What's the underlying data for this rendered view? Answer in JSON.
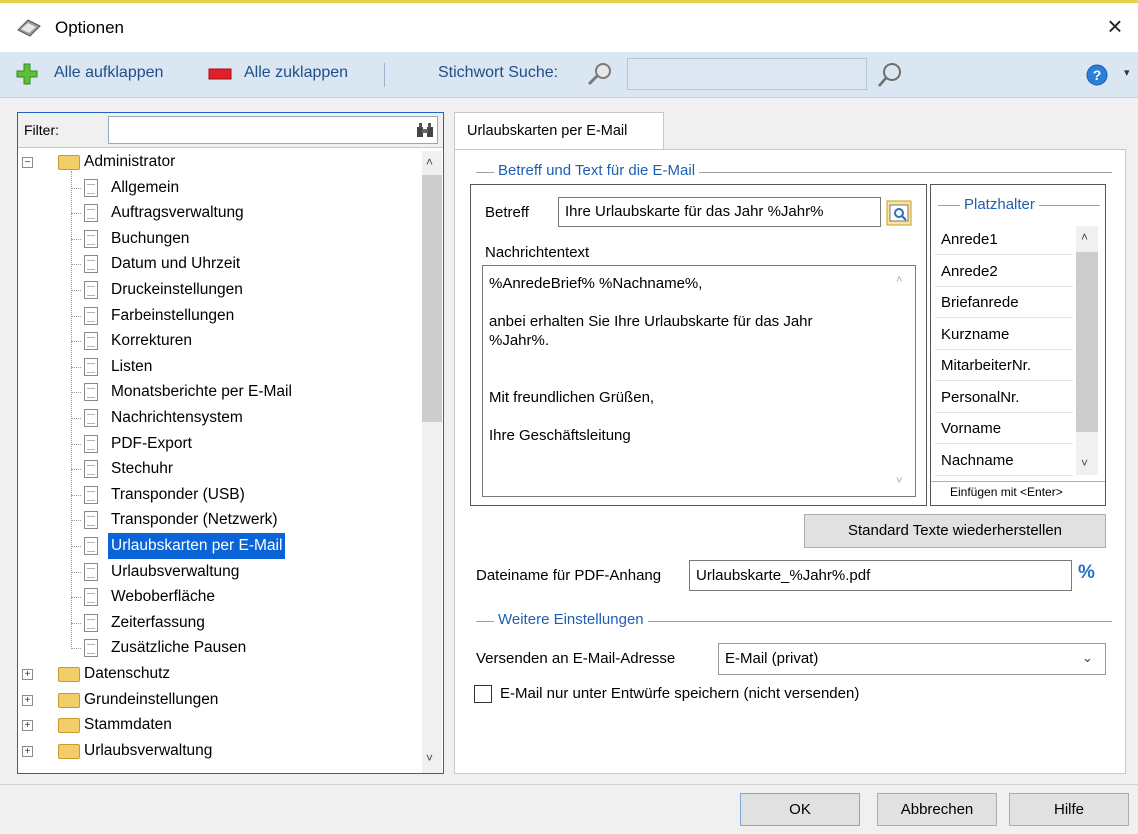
{
  "window": {
    "title": "Optionen",
    "close_label": "×"
  },
  "toolbar": {
    "expand_all": "Alle aufklappen",
    "collapse_all": "Alle zuklappen",
    "keyword_search": "Stichwort Suche:",
    "search_value": "",
    "help_icon": "help-icon"
  },
  "filter": {
    "label": "Filter:",
    "value": ""
  },
  "tree": {
    "root": "Administrator",
    "children": [
      "Allgemein",
      "Auftragsverwaltung",
      "Buchungen",
      "Datum und Uhrzeit",
      "Druckeinstellungen",
      "Farbeinstellungen",
      "Korrekturen",
      "Listen",
      "Monatsberichte per E-Mail",
      "Nachrichtensystem",
      "PDF-Export",
      "Stechuhr",
      "Transponder (USB)",
      "Transponder (Netzwerk)",
      "Urlaubskarten per E-Mail",
      "Urlaubsverwaltung",
      "Weboberfläche",
      "Zeiterfassung",
      "Zusätzliche Pausen"
    ],
    "selected": "Urlaubskarten per E-Mail",
    "other_roots": [
      "Datenschutz",
      "Grundeinstellungen",
      "Stammdaten",
      "Urlaubsverwaltung"
    ]
  },
  "tab": {
    "label": "Urlaubskarten per E-Mail"
  },
  "mail": {
    "section_title": "Betreff und Text für die E-Mail",
    "subject_label": "Betreff",
    "subject_value": "Ihre Urlaubskarte für das Jahr %Jahr%",
    "body_label": "Nachrichtentext",
    "body_lines": [
      "%AnredeBrief% %Nachname%,",
      "",
      "anbei erhalten Sie Ihre Urlaubskarte für das Jahr",
      "%Jahr%.",
      "",
      "",
      "Mit freundlichen Grüßen,",
      "",
      "Ihre Geschäftsleitung"
    ]
  },
  "placeholders": {
    "title": "Platzhalter",
    "items": [
      "Anrede1",
      "Anrede2",
      "Briefanrede",
      "Kurzname",
      "MitarbeiterNr.",
      "PersonalNr.",
      "Vorname",
      "Nachname"
    ],
    "hint": "Einfügen mit <Enter>"
  },
  "restore_button": "Standard Texte wiederherstellen",
  "pdf": {
    "label": "Dateiname für PDF-Anhang",
    "value": "Urlaubskarte_%Jahr%.pdf"
  },
  "more": {
    "section_title": "Weitere Einstellungen",
    "send_label": "Versenden an E-Mail-Adresse",
    "send_value": "E-Mail (privat)",
    "draft_checkbox_label": "E-Mail nur unter Entwürfe speichern (nicht versenden)",
    "draft_checked": false
  },
  "buttons": {
    "ok": "OK",
    "cancel": "Abbrechen",
    "help": "Hilfe"
  },
  "colors": {
    "accent": "#1f5fb0",
    "selection": "#0a64d8",
    "toolbar": "#dbe6f3"
  }
}
